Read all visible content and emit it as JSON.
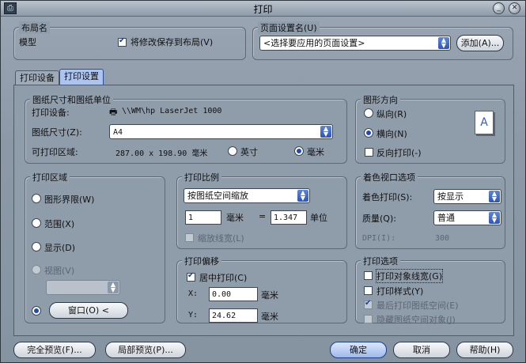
{
  "window": {
    "title": "打印",
    "sys_icon": "printer-app-icon",
    "minimize_glyph": "_",
    "close_glyph": "✕"
  },
  "layout_group": {
    "title": "布局名",
    "name": "模型",
    "save_checkbox_label": "将修改保存到布局(V)",
    "save_checked": true
  },
  "page_setup": {
    "title": "页面设置名(U)",
    "selected": "<选择要应用的页面设置>",
    "add_button": "添加(A)..."
  },
  "tabs": [
    {
      "label": "打印设备"
    },
    {
      "label": "打印设置"
    }
  ],
  "paper": {
    "title": "图纸尺寸和图纸单位",
    "device_label": "打印设备:",
    "device_value": "\\\\WM\\hp LaserJet 1000",
    "size_label": "图纸尺寸(Z):",
    "size_value": "A4",
    "printable_label": "可打印区域:",
    "printable_value": "287.00 x 198.90 毫米",
    "unit_inch": "英寸",
    "unit_mm": "毫米",
    "unit_selected": "mm"
  },
  "orientation": {
    "title": "图形方向",
    "portrait": "纵向(R)",
    "landscape": "横向(N)",
    "reverse": "反向打印(-)",
    "selected": "landscape",
    "reverse_checked": false,
    "preview_letter": "A"
  },
  "print_area": {
    "title": "打印区域",
    "limits": "图形界限(W)",
    "extents": "范围(X)",
    "display": "显示(D)",
    "view": "视图(V)",
    "view_value": "",
    "window_button": "窗口(O) <",
    "selected": "window"
  },
  "scale": {
    "title": "打印比例",
    "fit_value": "按图纸空间缩放",
    "num1": "1",
    "unit_mm": "毫米",
    "equals": "=",
    "num2": "1.347",
    "unit_label": "单位",
    "scale_lineweights": "缩放线宽(L)"
  },
  "offset": {
    "title": "打印偏移",
    "center": "居中打印(C)",
    "center_checked": true,
    "x_label": "X:",
    "x_value": "0.00",
    "y_label": "Y:",
    "y_value": "24.62",
    "unit": "毫米"
  },
  "shaded": {
    "title": "着色视口选项",
    "shade_label": "着色打印(S):",
    "shade_value": "按显示",
    "quality_label": "质量(Q):",
    "quality_value": "普通",
    "dpi_label": "DPI(I):",
    "dpi_value": "300"
  },
  "options": {
    "title": "打印选项",
    "items": [
      {
        "label": "打印对象线宽(G)",
        "checked": false,
        "enabled": true
      },
      {
        "label": "打印样式(Y)",
        "checked": false,
        "enabled": true
      },
      {
        "label": "最后打印图纸空间(E)",
        "checked": true,
        "enabled": false
      },
      {
        "label": "隐藏图纸空间对象(J)",
        "checked": false,
        "enabled": false
      }
    ]
  },
  "footer": {
    "full_preview": "完全预览(F)...",
    "partial_preview": "局部预览(P)...",
    "ok": "确定",
    "cancel": "取消",
    "help": "帮助(H)"
  }
}
